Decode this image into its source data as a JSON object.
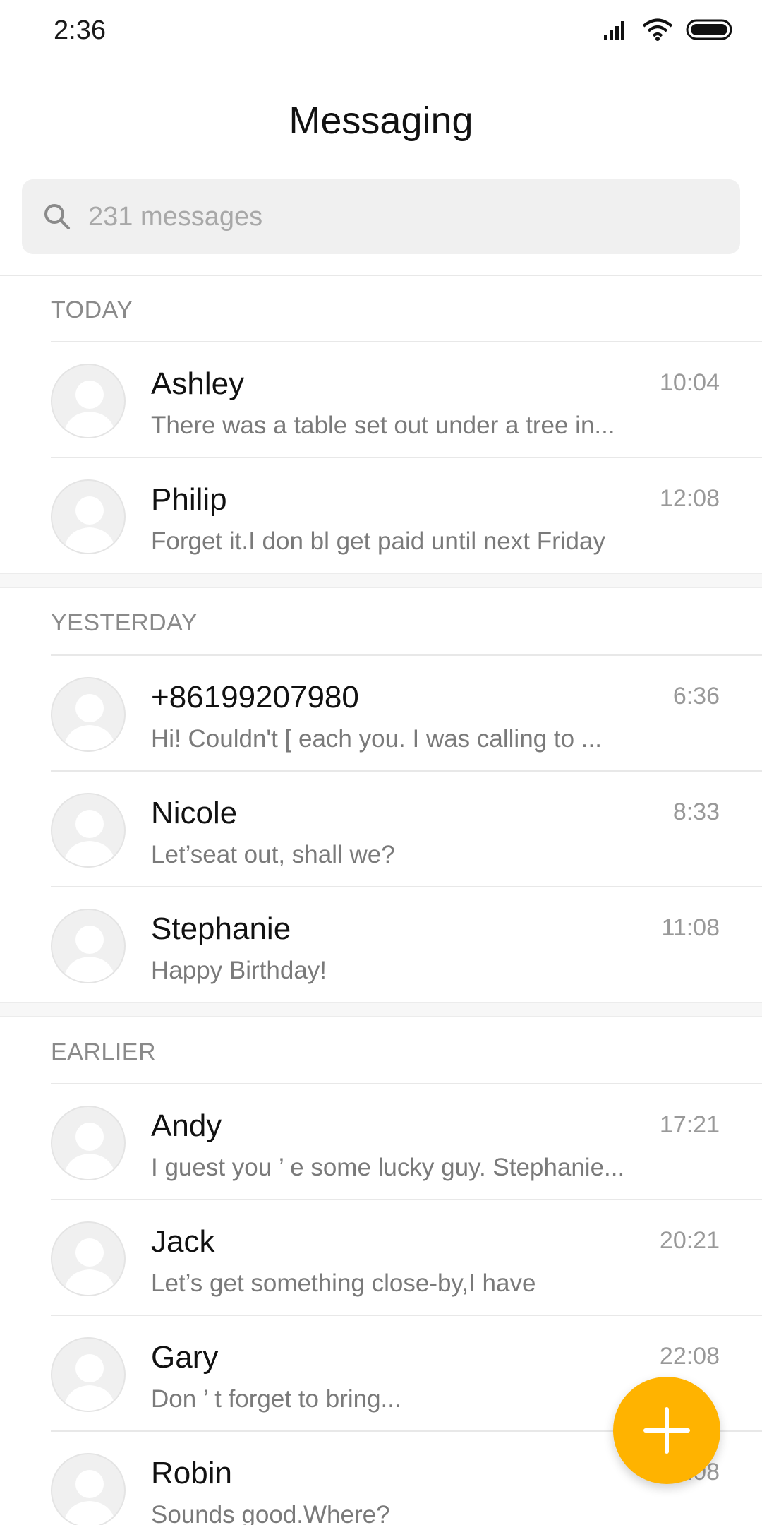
{
  "status_bar": {
    "time": "2:36",
    "icons": [
      "signal-icon",
      "wifi-icon",
      "battery-icon"
    ]
  },
  "header": {
    "title": "Messaging"
  },
  "search": {
    "placeholder": "231 messages",
    "icon": "search-icon"
  },
  "sections": [
    {
      "label": "TODAY",
      "items": [
        {
          "name": "Ashley",
          "time": "10:04",
          "preview": "There was a table set out under a tree in..."
        },
        {
          "name": "Philip",
          "time": "12:08",
          "preview": "Forget it.I don bl get paid until next Friday"
        }
      ]
    },
    {
      "label": "YESTERDAY",
      "items": [
        {
          "name": "+86199207980",
          "time": "6:36",
          "preview": "Hi! Couldn't [ each you. I was calling to ..."
        },
        {
          "name": "Nicole",
          "time": "8:33",
          "preview": "Let’seat out, shall we?"
        },
        {
          "name": "Stephanie",
          "time": "11:08",
          "preview": "Happy Birthday!"
        }
      ]
    },
    {
      "label": "EARLIER",
      "items": [
        {
          "name": "Andy",
          "time": "17:21",
          "preview": "I guest you ’ e some lucky guy. Stephanie..."
        },
        {
          "name": "Jack",
          "time": "20:21",
          "preview": "Let’s get something close-by,I have"
        },
        {
          "name": "Gary",
          "time": "22:08",
          "preview": "Don ’ t forget to bring..."
        },
        {
          "name": "Robin",
          "time": "22:08",
          "preview": "Sounds good.Where?"
        }
      ]
    }
  ],
  "fab": {
    "icon": "plus-icon"
  },
  "colors": {
    "accent": "#ffb300",
    "search_bg": "#f0f0f0",
    "divider": "#e8e8e8",
    "muted_text": "#7a7a7a"
  }
}
